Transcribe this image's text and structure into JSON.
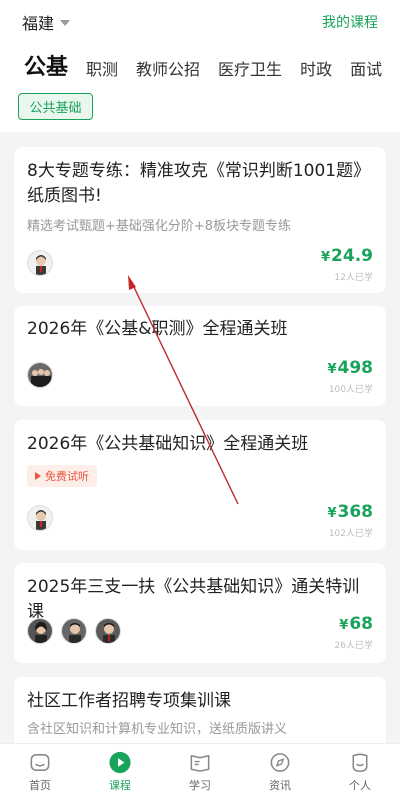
{
  "header": {
    "region": "福建",
    "my_course": "我的课程"
  },
  "tabs": [
    "公基",
    "职测",
    "教师公招",
    "医疗卫生",
    "时政",
    "面试"
  ],
  "filter": {
    "selected": "公共基础"
  },
  "courses": [
    {
      "title": "8大专题专练：精准攻克《常识判断1001题》纸质图书!",
      "subtitle": "精选考试甄题+基础强化分阶+8板块专题专练",
      "price": "24.9",
      "currency": "¥",
      "enrolled": "12人已学"
    },
    {
      "title": "2026年《公基&职测》全程通关班",
      "price": "498",
      "currency": "¥",
      "enrolled": "100人已学"
    },
    {
      "title": "2026年《公共基础知识》全程通关班",
      "badge": "免费试听",
      "price": "368",
      "currency": "¥",
      "enrolled": "102人已学"
    },
    {
      "title": "2025年三支一扶《公共基础知识》通关特训课",
      "price": "68",
      "currency": "¥",
      "enrolled": "26人已学"
    },
    {
      "title": "社区工作者招聘专项集训课",
      "subtitle": "含社区知识和计算机专业知识，送纸质版讲义"
    }
  ],
  "bottom_nav": [
    {
      "label": "首页",
      "icon": "home-icon"
    },
    {
      "label": "课程",
      "icon": "course-play-icon",
      "active": true
    },
    {
      "label": "学习",
      "icon": "book-icon"
    },
    {
      "label": "资讯",
      "icon": "compass-icon"
    },
    {
      "label": "个人",
      "icon": "profile-icon"
    }
  ],
  "colors": {
    "brand": "#1aa35b",
    "annotation_arrow": "#c0282d",
    "free_trial": "#e8573b"
  }
}
